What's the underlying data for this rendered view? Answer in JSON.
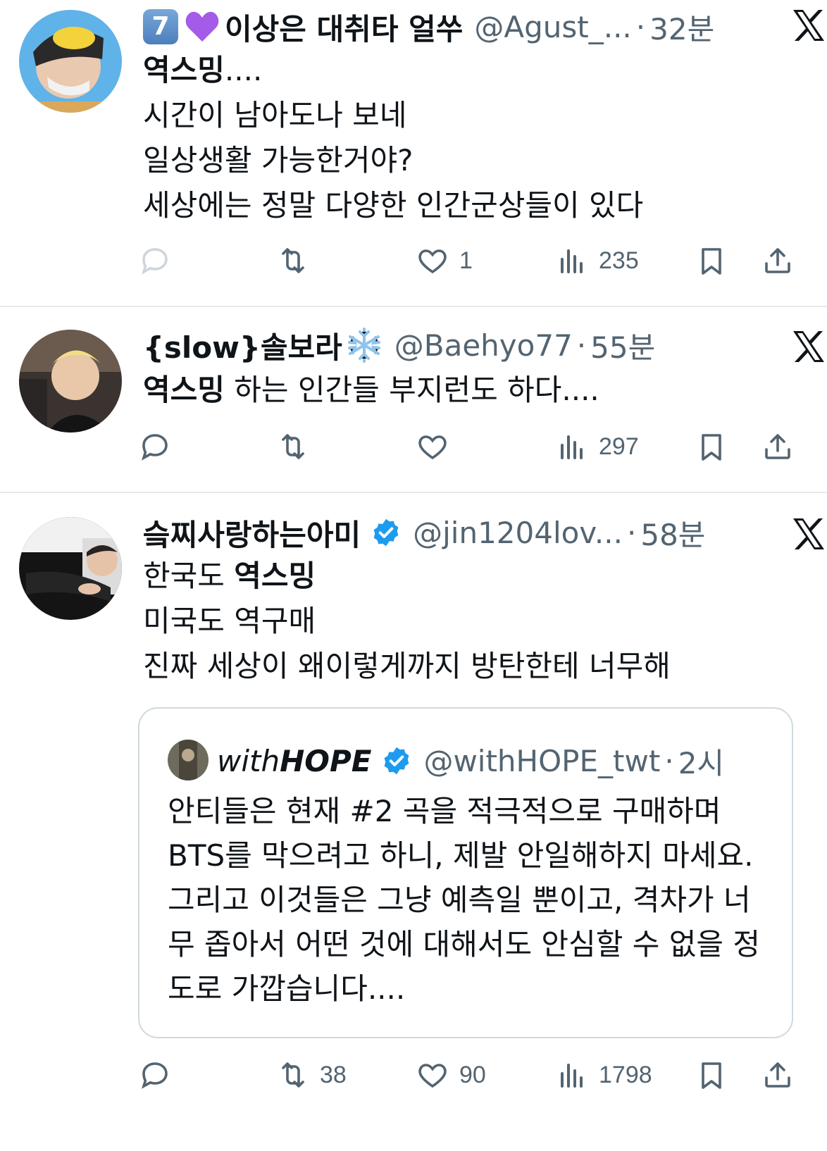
{
  "tweets": [
    {
      "display_name": "이상은 대취타 얼쑤",
      "name_prefix_emoji": "7",
      "handle": "@Agust_...",
      "separator": "·",
      "time": "32분",
      "lines": [
        {
          "bold": "역스밍",
          "rest": "...."
        },
        {
          "bold": "",
          "rest": "시간이 남아도나 보네"
        },
        {
          "bold": "",
          "rest": "일상생활 가능한거야?"
        },
        {
          "bold": "",
          "rest": "세상에는 정말 다양한 인간군상들이 있다"
        }
      ],
      "actions": {
        "reply": "",
        "retweet": "",
        "like": "1",
        "views": "235"
      }
    },
    {
      "display_name": "{slow}솔보라",
      "handle": "@Baehyo77",
      "separator": "·",
      "time": "55분",
      "lines": [
        {
          "bold": "역스밍",
          "rest": " 하는 인간들 부지런도 하다...."
        }
      ],
      "actions": {
        "reply": "",
        "retweet": "",
        "like": "",
        "views": "297"
      }
    },
    {
      "display_name": "슼찌사랑하는아미",
      "handle": "@jin1204lov...",
      "separator": "·",
      "time": "58분",
      "lines": [
        {
          "bold": "",
          "rest": "한국도 ",
          "bold2": "역스밍"
        },
        {
          "bold": "",
          "rest": "미국도 역구매"
        },
        {
          "bold": "",
          "rest": "진짜 세상이 왜이렇게까지 방탄한테 너무해"
        }
      ],
      "quote": {
        "display_name_light": "with",
        "display_name_bold": "HOPE",
        "handle": "@withHOPE_twt",
        "separator": "·",
        "time": "2시",
        "text": "안티들은 현재 #2 곡을 적극적으로 구매하며 BTS를 막으려고 하니, 제발 안일해하지 마세요. 그리고 이것들은 그냥 예측일 뿐이고, 격차가 너무 좁아서 어떤 것에 대해서도 안심할 수 없을 정도로 가깝습니다...."
      },
      "actions": {
        "reply": "",
        "retweet": "38",
        "like": "90",
        "views": "1798"
      }
    }
  ],
  "icons": {
    "reply": "reply-bubble-icon",
    "retweet": "retweet-icon",
    "like": "heart-icon",
    "views": "views-bar-icon",
    "bookmark": "bookmark-icon",
    "share": "share-icon",
    "x_logo": "x-logo-icon",
    "verified": "verified-badge-icon"
  },
  "colors": {
    "text": "#0f1419",
    "muted": "#536471",
    "verified": "#1d9bf0",
    "divider": "#e6e8ea",
    "quote_border": "#cfd9de"
  }
}
